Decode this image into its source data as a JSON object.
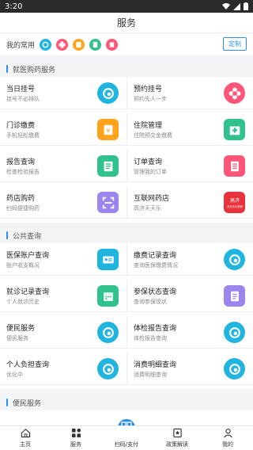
{
  "statusbar": {
    "time": "3:20"
  },
  "header": {
    "title": "服务"
  },
  "favorites": {
    "label": "我的常用",
    "edit_label": "定制"
  },
  "sections": {
    "medical": {
      "title": "就医购药服务"
    },
    "public": {
      "title": "公共查询"
    },
    "convenience": {
      "title": "便民服务"
    }
  },
  "medical_items": [
    {
      "title": "当日挂号",
      "sub": "挂号不必排队",
      "icon": "swirl-icon"
    },
    {
      "title": "预约挂号",
      "sub": "预约先人一步",
      "icon": "cross-flower-icon"
    },
    {
      "title": "门诊缴费",
      "sub": "手机轻松缴费",
      "icon": "payment-icon"
    },
    {
      "title": "住院管理",
      "sub": "住院预交金缴费",
      "icon": "hospital-icon"
    },
    {
      "title": "报告查询",
      "sub": "检查检验报告",
      "icon": "report-icon"
    },
    {
      "title": "订单查询",
      "sub": "管理我的订单",
      "icon": "order-icon"
    },
    {
      "title": "药店购药",
      "sub": "扫码便捷购药",
      "icon": "scan-icon"
    },
    {
      "title": "互联网药店",
      "sub": "高济天天乐",
      "icon": "pharmacy-logo-icon",
      "badge": "高济\n天天乐大药房"
    }
  ],
  "public_items": [
    {
      "title": "医保账户查询",
      "sub": "账户收支概况",
      "icon": "id-card-icon"
    },
    {
      "title": "缴费记录查询",
      "sub": "查询医保缴费情况",
      "icon": "swirl-icon"
    },
    {
      "title": "就诊记录查询",
      "sub": "个人就诊历史",
      "icon": "calendar-icon"
    },
    {
      "title": "参保状态查询",
      "sub": "查询参保现状",
      "icon": "document-icon"
    },
    {
      "title": "便民服务",
      "sub": "便民服务",
      "icon": "swirl-icon"
    },
    {
      "title": "体检报告查询",
      "sub": "体检报告查询",
      "icon": "swirl-icon"
    },
    {
      "title": "个人负担查询",
      "sub": "优化中",
      "icon": "swirl-icon"
    },
    {
      "title": "消费明细查询",
      "sub": "消费明细查询",
      "icon": "swirl-icon"
    }
  ],
  "tabs": [
    {
      "label": "主页",
      "icon": "home-icon"
    },
    {
      "label": "服务",
      "icon": "grid-icon"
    },
    {
      "label": "扫码/支付",
      "icon": "qr-icon"
    },
    {
      "label": "政策解读",
      "icon": "policy-icon"
    },
    {
      "label": "我的",
      "icon": "user-icon"
    }
  ],
  "colors": {
    "accent": "#2a8ee8",
    "teal": "#1fb5e0",
    "pink": "#ff5577",
    "orange": "#ffa31a",
    "green": "#2fc28a",
    "purple": "#9b86f0",
    "red": "#e8323c"
  }
}
